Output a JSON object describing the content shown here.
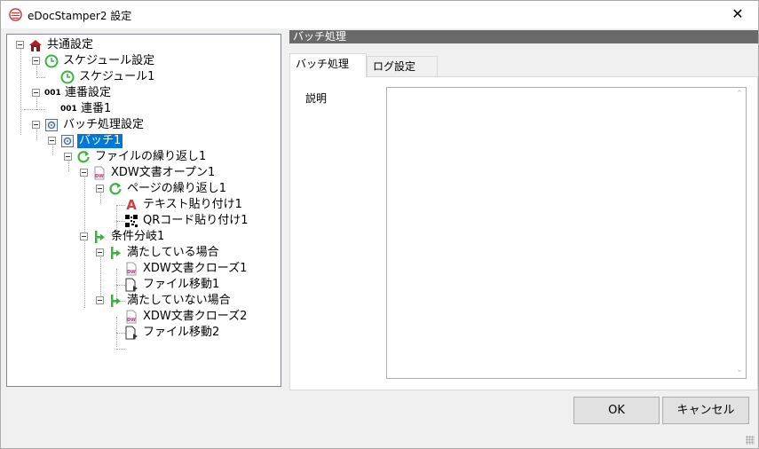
{
  "window": {
    "title": "eDocStamper2 設定",
    "close_glyph": "✕"
  },
  "tree": {
    "n0": "共通設定",
    "n1": "スケジュール設定",
    "n2": "スケジュール1",
    "n3": "連番設定",
    "n4": "連番1",
    "n5": "バッチ処理設定",
    "n6": "バッチ1",
    "n7": "ファイルの繰り返し1",
    "n8": "XDW文書オープン1",
    "n9": "ページの繰り返し1",
    "n10": "テキスト貼り付け1",
    "n11": "QRコード貼り付け1",
    "n12": "条件分岐1",
    "n13": "満たしている場合",
    "n14": "XDW文書クローズ1",
    "n15": "ファイル移動1",
    "n16": "満たしていない場合",
    "n17": "XDW文書クローズ2",
    "n18": "ファイル移動2",
    "seq_icon_text": "001",
    "text_icon_glyph": "A",
    "dw_icon_text": "DW"
  },
  "panel": {
    "header": "バッチ処理",
    "tabs": [
      "バッチ処理",
      "ログ設定"
    ],
    "description_label": "説明",
    "description_value": ""
  },
  "buttons": {
    "ok": "OK",
    "cancel": "キャンセル"
  },
  "colors": {
    "selection": "#0078d7",
    "header_bar": "#696969",
    "green_icon": "#3cb43c",
    "red_icon": "#d93a3a"
  }
}
